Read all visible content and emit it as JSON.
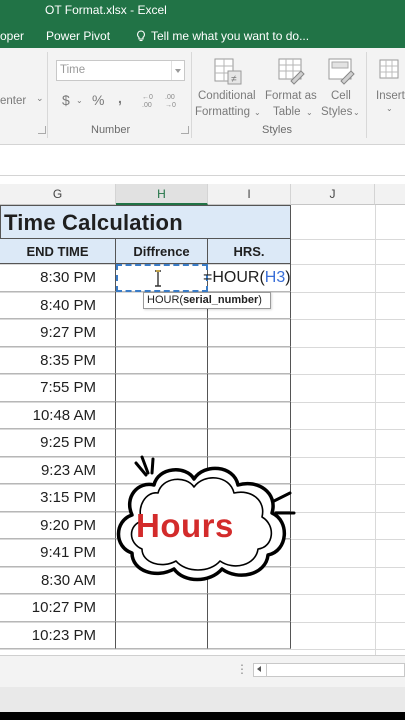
{
  "window": {
    "title": "OT Format.xlsx - Excel"
  },
  "tabs": [
    {
      "label": "oper"
    },
    {
      "label": "Power Pivot"
    },
    {
      "label": "Tell me what you want to do..."
    }
  ],
  "ribbon": {
    "alignment_partial": "enter",
    "number_format_value": "Time",
    "currency_symbol": "$",
    "percent_symbol": "%",
    "comma_symbol": ",",
    "number_group_label": "Number",
    "conditional_formatting": [
      "Conditional",
      "Formatting"
    ],
    "format_as_table": [
      "Format as",
      "Table"
    ],
    "cell_styles": [
      "Cell",
      "Styles"
    ],
    "styles_group_label": "Styles",
    "insert_label": "Insert"
  },
  "columns": [
    {
      "label": "G"
    },
    {
      "label": "H"
    },
    {
      "label": "I"
    },
    {
      "label": "J"
    }
  ],
  "sheet": {
    "title": "Time Calculation",
    "headers": {
      "end_time": "END TIME",
      "difference": "Diffrence",
      "hrs": "HRS."
    },
    "end_times": [
      "8:30 PM",
      "8:40 PM",
      "9:27 PM",
      "8:35 PM",
      "7:55 PM",
      "10:48 AM",
      "9:25 PM",
      "9:23 AM",
      "3:15 PM",
      "9:20 PM",
      "9:41 PM",
      "8:30 AM",
      "10:27 PM",
      "10:23 PM"
    ]
  },
  "formula_edit": {
    "prefix": "=HOUR(",
    "ref": "H3",
    "suffix": ")",
    "tooltip_fn": "HOUR(",
    "tooltip_arg": "serial_number",
    "tooltip_close": ")"
  },
  "sticker": {
    "text": "Hours",
    "text_color": "#d32b2b"
  },
  "accent": "#217346"
}
